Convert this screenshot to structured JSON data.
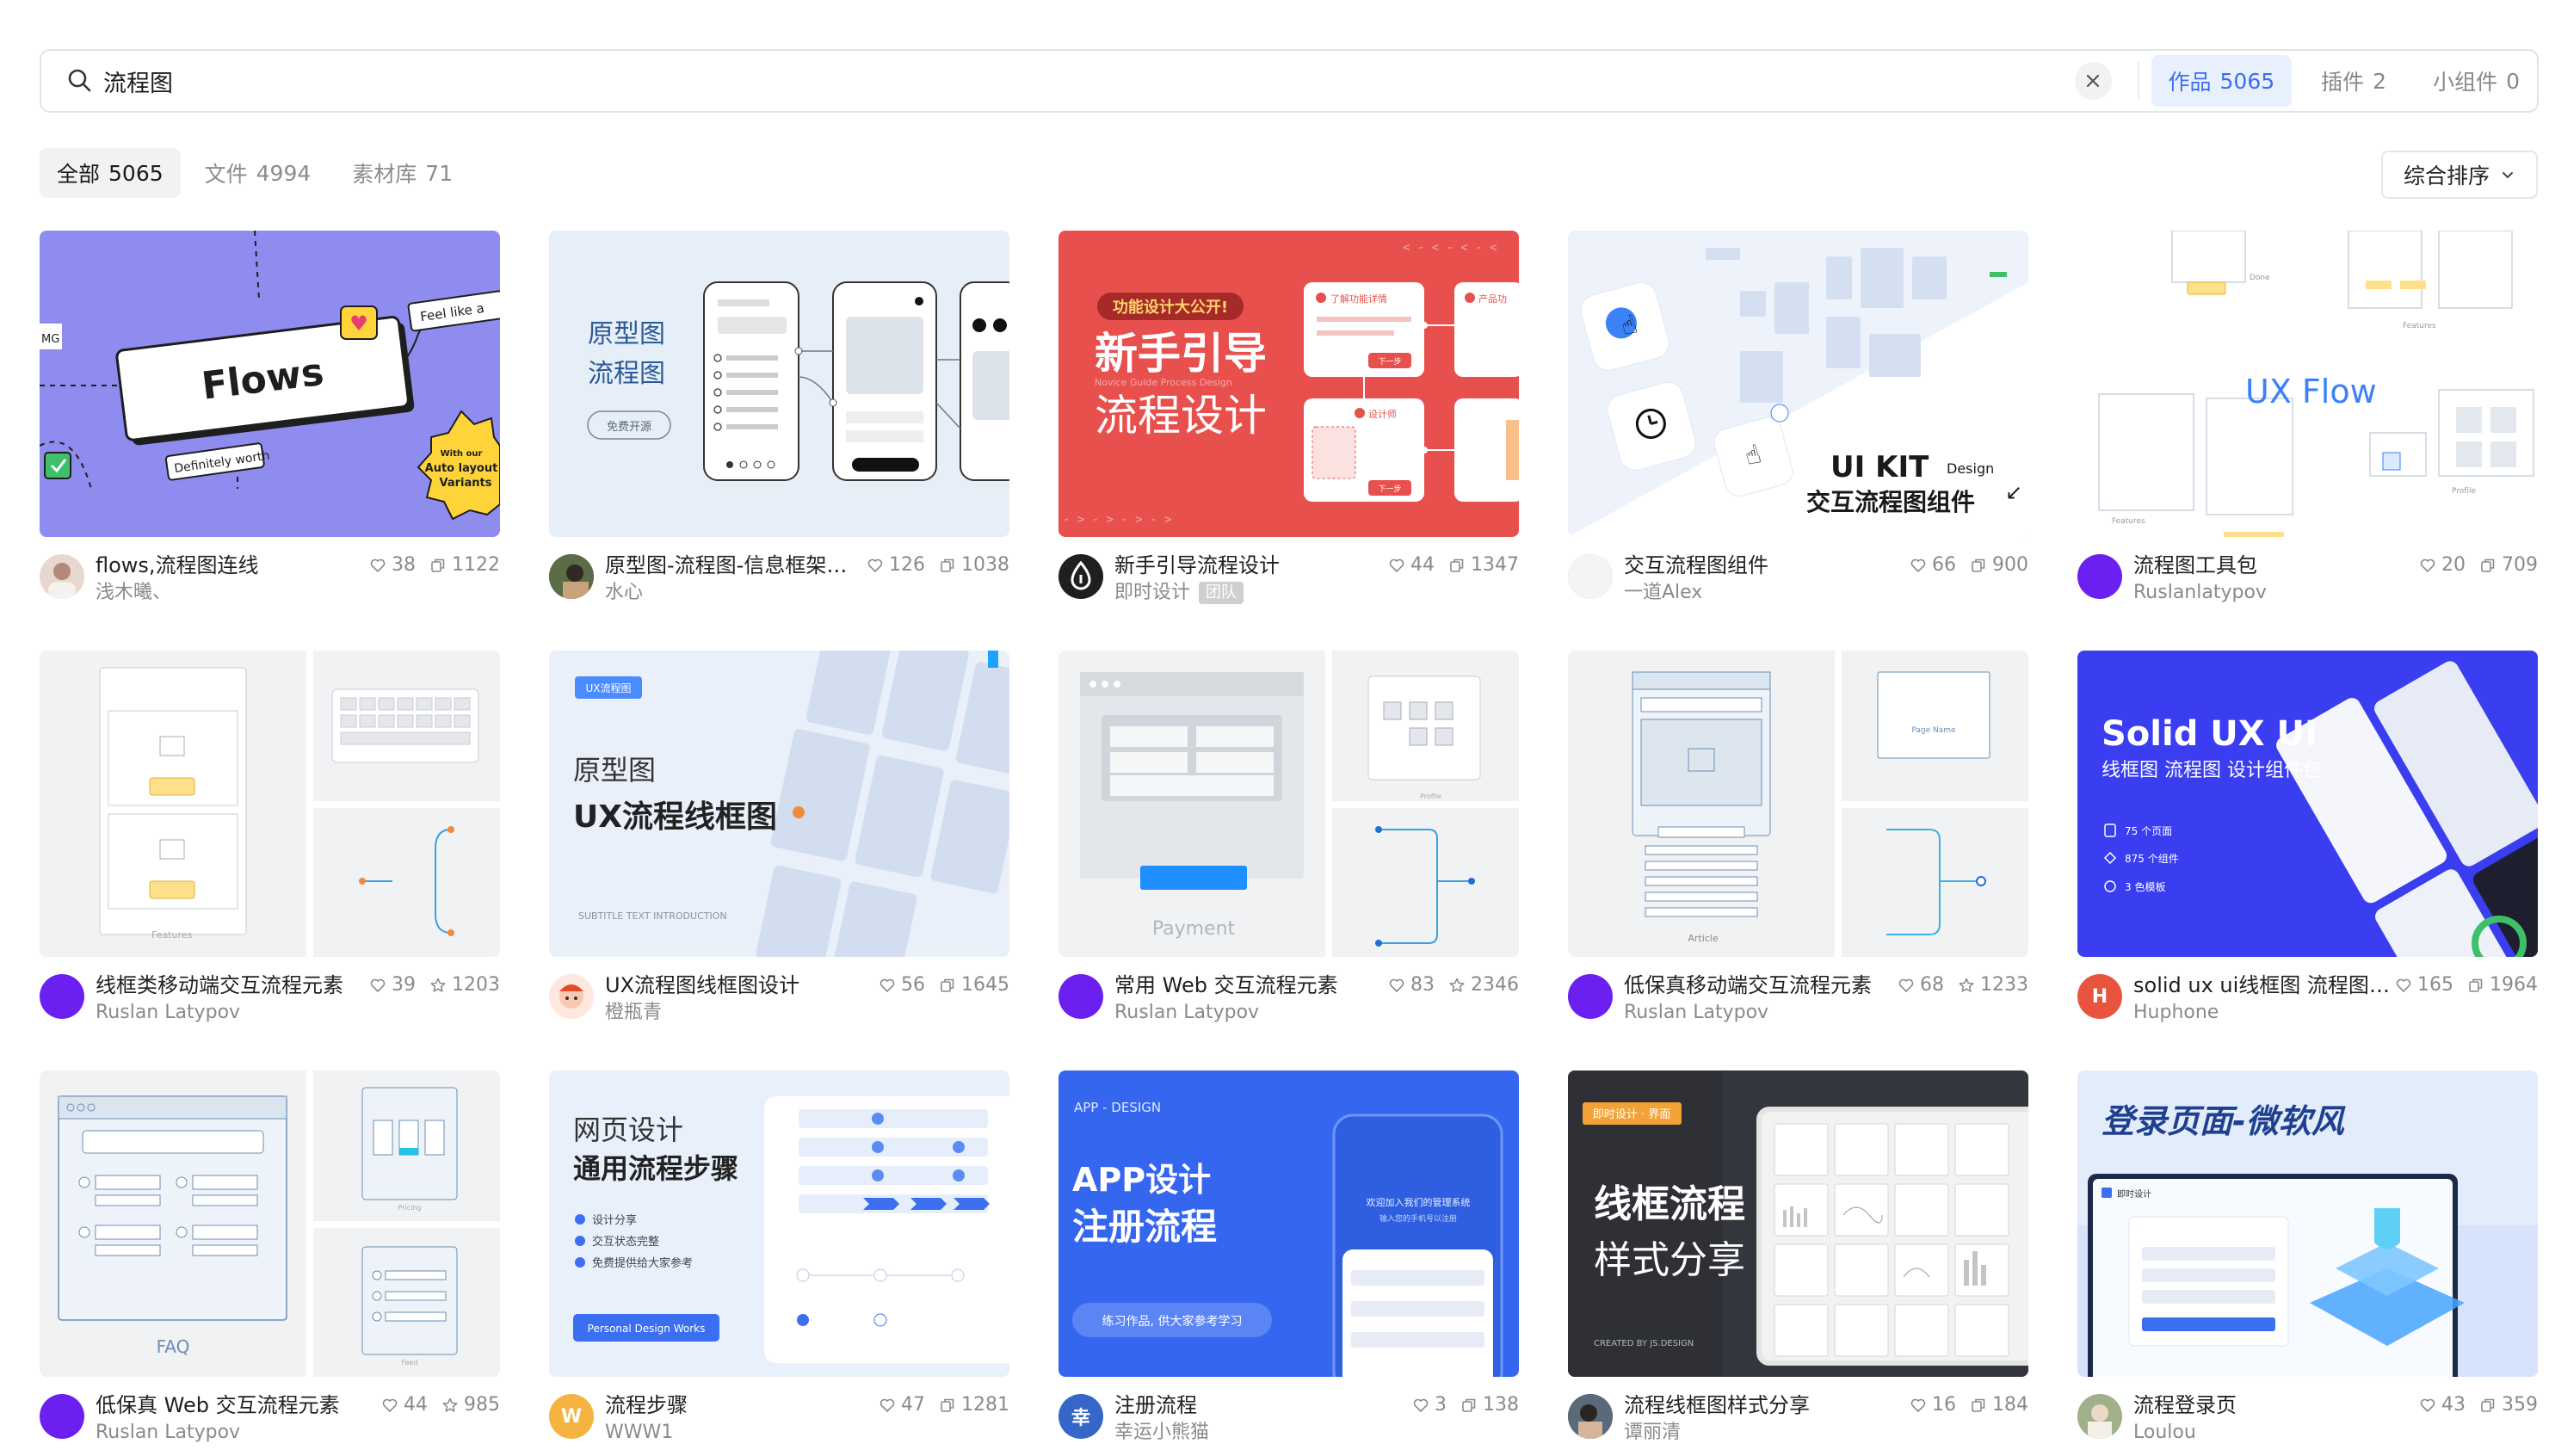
{
  "search": {
    "value": "流程图",
    "type_tabs": [
      {
        "label": "作品",
        "count": "5065"
      },
      {
        "label": "插件",
        "count": "2"
      },
      {
        "label": "小组件",
        "count": "0"
      }
    ]
  },
  "filters": {
    "tabs": [
      {
        "label": "全部",
        "count": "5065"
      },
      {
        "label": "文件",
        "count": "4994"
      },
      {
        "label": "素材库",
        "count": "71"
      }
    ],
    "sort_label": "综合排序"
  },
  "colors": {
    "accent": "#3b6ff0",
    "accent_bg": "#e9f0fd"
  },
  "cards": [
    {
      "title": "flows,流程图连线",
      "author": "浅木曦、",
      "likes": "38",
      "second": "1122",
      "second_icon": "copy-icon",
      "avatar_icon": "photo-avatar"
    },
    {
      "title": "原型图-流程图-信息框架图...",
      "author": "水心",
      "likes": "126",
      "second": "1038",
      "second_icon": "copy-icon",
      "avatar_icon": "photo-avatar"
    },
    {
      "title": "新手引导流程设计",
      "author": "即时设计",
      "badge": "团队",
      "likes": "44",
      "second": "1347",
      "second_icon": "copy-icon",
      "avatar_icon": "drop-logo"
    },
    {
      "title": "交互流程图组件",
      "author": "一道Alex",
      "likes": "66",
      "second": "900",
      "second_icon": "copy-icon",
      "avatar_icon": "blank-avatar"
    },
    {
      "title": "流程图工具包",
      "author": "Ruslanlatypov",
      "likes": "20",
      "second": "709",
      "second_icon": "copy-icon",
      "avatar_icon": "purple-avatar"
    },
    {
      "title": "线框类移动端交互流程元素",
      "author": "Ruslan Latypov",
      "likes": "39",
      "second": "1203",
      "second_icon": "star-icon",
      "avatar_icon": "purple-avatar"
    },
    {
      "title": "UX流程图线框图设计",
      "author": "橙瓶青",
      "likes": "56",
      "second": "1645",
      "second_icon": "copy-icon",
      "avatar_icon": "photo-avatar"
    },
    {
      "title": "常用 Web 交互流程元素",
      "author": "Ruslan Latypov",
      "likes": "83",
      "second": "2346",
      "second_icon": "star-icon",
      "avatar_icon": "purple-avatar"
    },
    {
      "title": "低保真移动端交互流程元素",
      "author": "Ruslan Latypov",
      "likes": "68",
      "second": "1233",
      "second_icon": "star-icon",
      "avatar_icon": "purple-avatar"
    },
    {
      "title": "solid ux ui线框图 流程图 ...",
      "author": "Huphone",
      "avatar_letter": "H",
      "likes": "165",
      "second": "1964",
      "second_icon": "copy-icon",
      "avatar_icon": "letter-avatar"
    },
    {
      "title": "低保真 Web 交互流程元素",
      "author": "Ruslan Latypov",
      "likes": "44",
      "second": "985",
      "second_icon": "star-icon",
      "avatar_icon": "purple-avatar"
    },
    {
      "title": "流程步骤",
      "author": "WWW1",
      "avatar_letter": "W",
      "likes": "47",
      "second": "1281",
      "second_icon": "copy-icon",
      "avatar_icon": "letter-avatar"
    },
    {
      "title": "注册流程",
      "author": "幸运小熊猫",
      "avatar_letter": "幸",
      "likes": "3",
      "second": "138",
      "second_icon": "copy-icon",
      "avatar_icon": "letter-avatar"
    },
    {
      "title": "流程线框图样式分享",
      "author": "谭丽清",
      "likes": "16",
      "second": "184",
      "second_icon": "copy-icon",
      "avatar_icon": "photo-avatar"
    },
    {
      "title": "流程登录页",
      "author": "Loulou",
      "likes": "43",
      "second": "359",
      "second_icon": "copy-icon",
      "avatar_icon": "photo-avatar"
    }
  ],
  "thumbs": {
    "t0": {
      "main": "Flows",
      "tag1": "Feel like a",
      "tag2": "Definitely worth",
      "tag3": "MG",
      "sticker": "With our best friends Auto layout Variants"
    },
    "t1": {
      "line1": "原型图",
      "line2": "流程图",
      "pill": "免费开源"
    },
    "t2": {
      "badge": "功能设计大公开!",
      "line1": "新手引导",
      "line2": "流程设计",
      "sub": "Novice Guide Process Design",
      "card1": "了解功能详情",
      "card2": "产品功",
      "card3": "设计师",
      "btn": "下一步"
    },
    "t3": {
      "kit": "UI KIT",
      "design": "Design",
      "cn": "交互流程图组件"
    },
    "t4": {
      "title": "UX Flow",
      "l1": "Done",
      "l2": "Features",
      "l3": "Features",
      "l4": "Profile"
    },
    "t5": {
      "label": "Features"
    },
    "t6": {
      "tag": "UX流程图",
      "line1": "原型图",
      "line2": "UX流程线框图",
      "sub": "SUBTITLE TEXT INTRODUCTION"
    },
    "t7": {
      "label": "Payment",
      "l2": "Profile"
    },
    "t8": {
      "label": "Article",
      "page": "Page Name"
    },
    "t9": {
      "title": "Solid UX UI",
      "sub": "线框图 流程图 设计组件包",
      "f1": "75 个页面",
      "f2": "875 个组件",
      "f3": "3 色模板"
    },
    "t10": {
      "label": "FAQ",
      "l2": "Pricing",
      "l3": "Feed"
    },
    "t11": {
      "line1": "网页设计",
      "line2": "通用流程步骤",
      "b1": "设计分享",
      "b2": "交互状态完整",
      "b3": "免费提供给大家参考",
      "btn": "Personal Design Works"
    },
    "t12": {
      "tag": "APP - DESIGN",
      "line1": "APP设计",
      "line2": "注册流程",
      "pill": "练习作品, 供大家参考学习",
      "phone1": "欢迎加入我们的管理系统",
      "phone2": "输入您的手机号以注册"
    },
    "t13": {
      "tag": "即时设计 · 界面",
      "line1": "线框流程",
      "line2": "样式分享",
      "credit": "CREATED BY JS.DESIGN"
    },
    "t14": {
      "title": "登录页面-微软风",
      "brand": "即时设计"
    }
  }
}
